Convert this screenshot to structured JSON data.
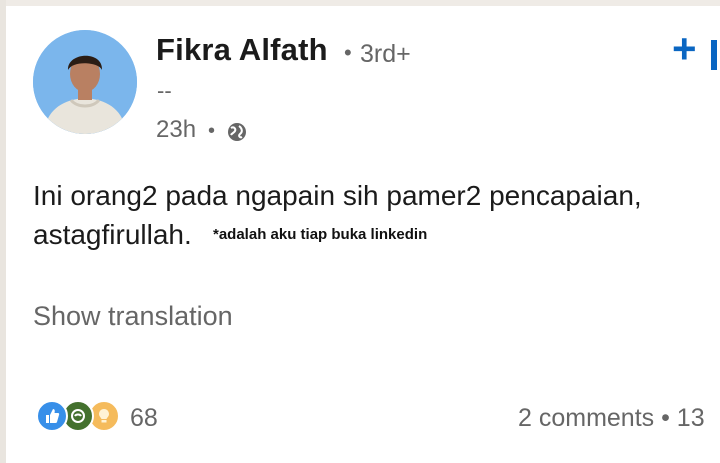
{
  "author": {
    "name": "Fikra Alfath",
    "separator": "•",
    "degree": "3rd+",
    "headline": "--",
    "time": "23h",
    "time_separator": "•",
    "visibility_icon": "globe-icon",
    "follow_label": "+"
  },
  "post": {
    "line1": "Ini orang2 pada ngapain sih pamer2 pencapaian,",
    "line2": "astagfirullah.",
    "overlay_caption": "*adalah aku tiap buka linkedin"
  },
  "translation": {
    "label": "Show translation"
  },
  "social": {
    "reaction_icons": [
      "like-icon",
      "celebrate-icon",
      "insightful-icon"
    ],
    "reaction_count": "68",
    "comments": "2 comments • 13"
  },
  "colors": {
    "accent": "#0a66c2",
    "muted": "#666666",
    "text": "#191919"
  }
}
